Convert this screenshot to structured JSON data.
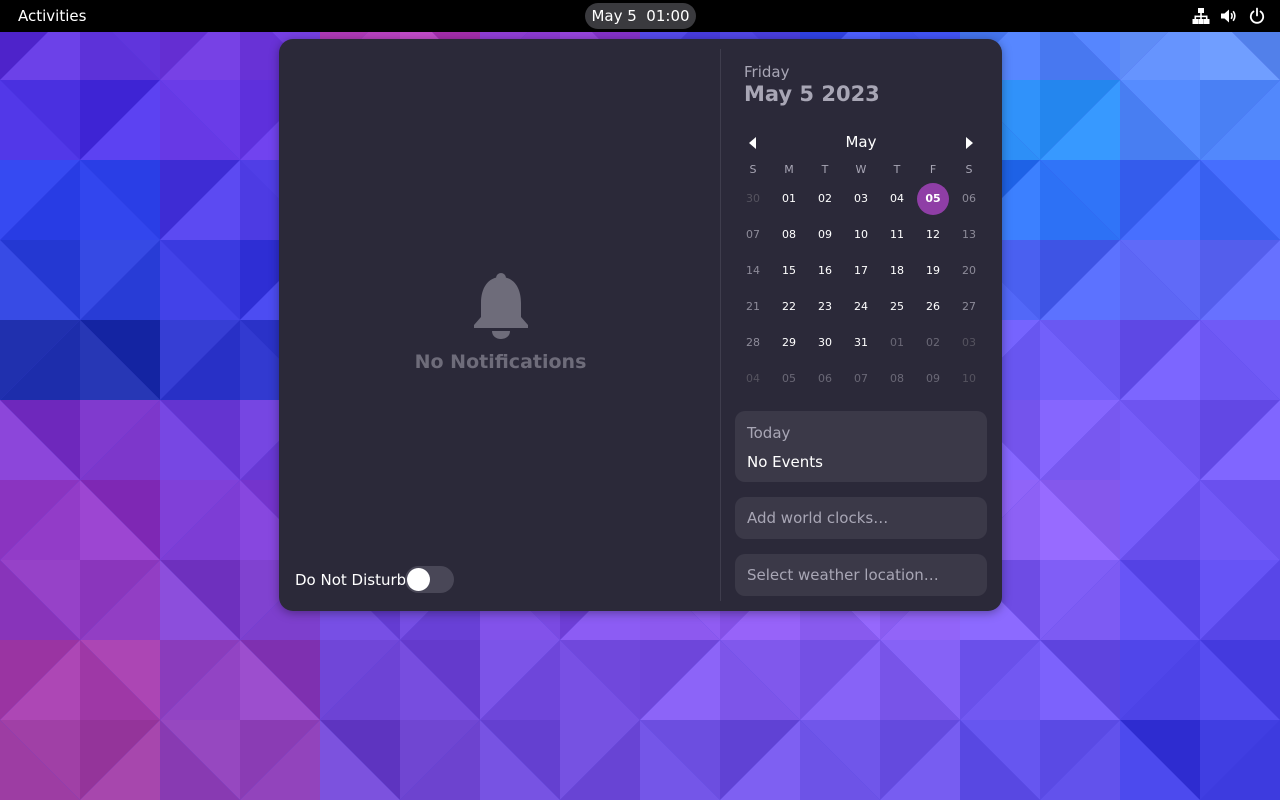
{
  "topbar": {
    "activities_label": "Activities",
    "clock_label": "May 5  01:00",
    "tray_icons": [
      "network-icon",
      "volume-icon",
      "power-icon"
    ]
  },
  "notifications": {
    "empty_icon": "bell-icon",
    "empty_text": "No Notifications",
    "dnd_label": "Do Not Disturb",
    "dnd_enabled": false
  },
  "calendar": {
    "weekday_title": "Friday",
    "date_title": "May 5 2023",
    "month_label": "May",
    "nav_prev_icon": "arrow-left-icon",
    "nav_next_icon": "arrow-right-icon",
    "weekday_headers": [
      "S",
      "M",
      "T",
      "W",
      "T",
      "F",
      "S"
    ],
    "weeks": [
      [
        "30",
        "01",
        "02",
        "03",
        "04",
        "05",
        "06"
      ],
      [
        "07",
        "08",
        "09",
        "10",
        "11",
        "12",
        "13"
      ],
      [
        "14",
        "15",
        "16",
        "17",
        "18",
        "19",
        "20"
      ],
      [
        "21",
        "22",
        "23",
        "24",
        "25",
        "26",
        "27"
      ],
      [
        "28",
        "29",
        "30",
        "31",
        "01",
        "02",
        "03"
      ],
      [
        "04",
        "05",
        "06",
        "07",
        "08",
        "09",
        "10"
      ]
    ],
    "selected_day": "05",
    "events_header": "Today",
    "events_text": "No Events",
    "world_clocks_label": "Add world clocks…",
    "weather_label": "Select weather location…"
  },
  "colors": {
    "panel_bg": "#2b2939",
    "card_bg": "#3b3948",
    "accent": "#8f3ea6",
    "topbar_bg": "#000000"
  }
}
